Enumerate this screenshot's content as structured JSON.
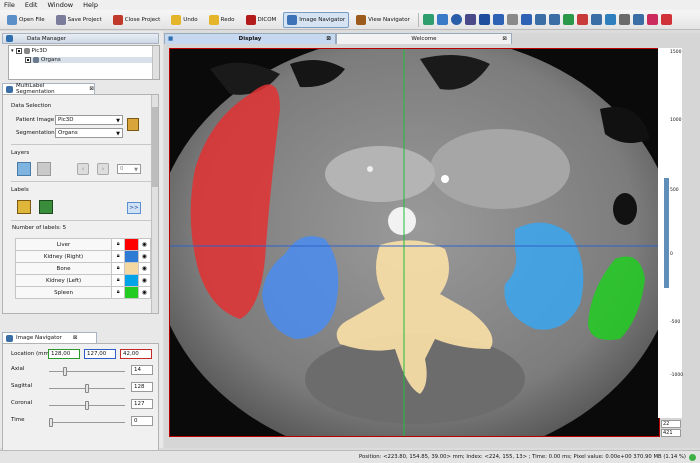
{
  "menu": [
    "File",
    "Edit",
    "Window",
    "Help"
  ],
  "toolbar": {
    "open_file": "Open File",
    "save_project": "Save Project",
    "close_project": "Close Project",
    "undo": "Undo",
    "redo": "Redo",
    "dicom": "DICOM",
    "image_navigator": "Image Navigator",
    "view_navigator": "View Navigator"
  },
  "data_manager": {
    "title": "Data Manager",
    "items": [
      "Pic3D",
      "Organs"
    ]
  },
  "multilabel": {
    "tab_title": "MultiLabel Segmentation",
    "data_selection": "Data Selection",
    "patient_image_label": "Patient Image",
    "patient_image_value": "Pic3D",
    "segmentation_label": "Segmentation",
    "segmentation_value": "Organs",
    "layers": "Layers",
    "layer_value": "0",
    "labels": "Labels",
    "expand": ">>",
    "number_of_labels": "Number of labels: 5",
    "rows": [
      {
        "name": "Liver",
        "color": "#ff0000"
      },
      {
        "name": "Kidney (Right)",
        "color": "#2e7bd6"
      },
      {
        "name": "Bone",
        "color": "#f3d8a1"
      },
      {
        "name": "Kidney (Left)",
        "color": "#00a2e8"
      },
      {
        "name": "Spleen",
        "color": "#22cc22"
      }
    ]
  },
  "navigator": {
    "title": "Image Navigator",
    "location_label": "Location (mm)",
    "loc_x": "128,00",
    "loc_y": "127,00",
    "loc_z": "42,00",
    "axial_label": "Axial",
    "axial_value": "14",
    "axial_level": 0.2,
    "sagittal_label": "Sagittal",
    "sagittal_value": "128",
    "sagittal_level": 0.5,
    "coronal_label": "Coronal",
    "coronal_value": "127",
    "coronal_level": 0.5,
    "time_label": "Time",
    "time_value": "0",
    "time_level": 0.0
  },
  "tabs": {
    "display": "Display",
    "welcome": "Welcome"
  },
  "ruler": {
    "ticks": [
      "1500",
      "1000",
      "500",
      "0",
      "-500",
      "-1000"
    ],
    "window_values": [
      "22",
      "421"
    ]
  },
  "status": "Position: <223.80, 154.85, 39.00> mm; Index: <224, 155, 13> ; Time: 0.00 ms; Pixel value: 0.00e+00  370.90 MB (1.14 %)",
  "colors": {
    "accent": "#3b6ea5",
    "crosshair_h": "#2e63c9",
    "crosshair_v": "#1fbf3a",
    "frame": "#bb0000"
  }
}
